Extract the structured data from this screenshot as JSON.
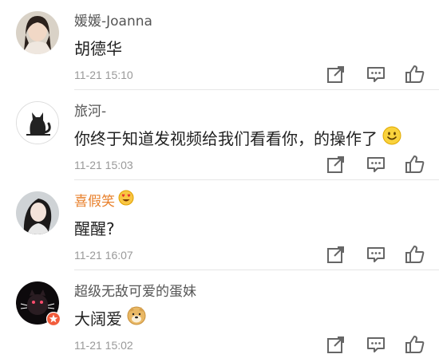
{
  "comments": [
    {
      "username": "媛媛-Joanna",
      "text": "胡德华",
      "time": "11-21 15:10",
      "avatar_icon": "avatar-girl-icon"
    },
    {
      "username": "旅河-",
      "text": "你终于知道发视频给我们看看你，的操作了",
      "time": "11-21 15:03",
      "avatar_icon": "avatar-cat-icon",
      "emoji": "smile-emoji-icon"
    },
    {
      "username": "喜假笑",
      "text": "醒醒?",
      "time": "11-21 16:07",
      "avatar_icon": "avatar-girl-icon",
      "badge": "heart-eyes-emoji-icon"
    },
    {
      "username": "超级无敌可爱的蛋妹",
      "text": "大阔爱",
      "time": "11-21 15:02",
      "avatar_icon": "avatar-cat-icon",
      "emoji": "doge-emoji-icon",
      "verified": "verified-badge-icon"
    }
  ],
  "colors": {
    "username": "#555555",
    "highlight_username": "#e8812d",
    "time": "#999999",
    "icon": "#666666"
  }
}
